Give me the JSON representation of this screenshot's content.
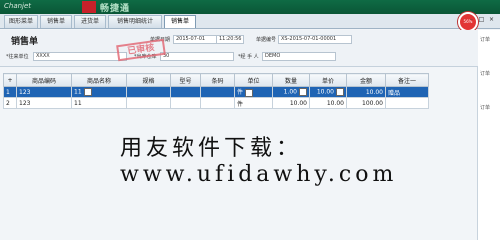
{
  "app": {
    "brand": "Chanjet",
    "title": "畅捷通"
  },
  "tabs": [
    "图形菜单",
    "销售单",
    "进货单",
    "销售明细统计",
    "销售单"
  ],
  "window_controls": {
    "minimize": "-",
    "restore": "□",
    "close": "×"
  },
  "status_gauge": "56%",
  "sidebar": {
    "items": [
      "订单",
      "订单",
      "订单"
    ]
  },
  "form": {
    "title": "销售单",
    "fields": {
      "date_label": "单据日期",
      "date_value": "2015-07-01",
      "time_value": "11:20:56",
      "docno_label": "单据编号",
      "docno_value": "XS-2015-07-01-00001",
      "customer_label": "*往来单位",
      "customer_value": "XXXX",
      "warehouse_label": "*出库仓库",
      "warehouse_value": "30",
      "handler_label": "*经 手 人",
      "handler_value": "DEMO"
    },
    "stamp": "已审核"
  },
  "grid": {
    "add_button": "+",
    "columns": [
      "商品编码",
      "商品名称",
      "规格",
      "型号",
      "条码",
      "单位",
      "数量",
      "单价",
      "金额",
      "备注一"
    ],
    "rows": [
      {
        "no": "1",
        "code": "123",
        "name": "11",
        "spec": "",
        "model": "",
        "barcode": "",
        "unit": "件",
        "qty": "1.00",
        "price": "10.00",
        "amount": "10.00",
        "note": "赠品"
      },
      {
        "no": "2",
        "code": "123",
        "name": "11",
        "spec": "",
        "model": "",
        "barcode": "",
        "unit": "件",
        "qty": "10.00",
        "price": "10.00",
        "amount": "100.00",
        "note": ""
      }
    ]
  },
  "watermark": "用友软件下载：www.ufidawhy.com"
}
